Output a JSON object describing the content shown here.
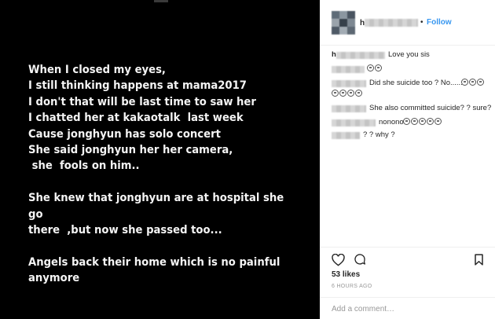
{
  "photo": {
    "caption": "When I closed my eyes,\nI still thinking happens at mama2017\nI don't that will be last time to saw her\nI chatted her at kakaotalk  last week\nCause jonghyun has solo concert\nShe said jonghyun her her camera,\n she  fools on him..\n\nShe knew that jonghyun are at hospital she go\nthere  ,but now she passed too...\n\nAngels back their home which is no painful\nanymore"
  },
  "header": {
    "username_initial": "h",
    "separator": "•",
    "follow_label": "Follow"
  },
  "comments": [
    {
      "name": "h",
      "text": "Love you sis",
      "emoji_count": 0
    },
    {
      "name": "",
      "text": "",
      "emoji_count": 2
    },
    {
      "name": "",
      "text": "Did she suicide too ? No......",
      "emoji_count": 3
    },
    {
      "name": "",
      "text": "",
      "emoji_count": 4
    },
    {
      "name": "",
      "text": "She also committed suicide? ? sure?",
      "emoji_count": 0
    },
    {
      "name": "",
      "text": "nonono",
      "emoji_count": 5
    },
    {
      "name": "",
      "text": "? ? why ?",
      "emoji_count": 0
    }
  ],
  "actions": {
    "icons": [
      "heart-icon",
      "comment-icon",
      "bookmark-icon"
    ]
  },
  "likes": "53 likes",
  "time": "6 HOURS AGO",
  "add_comment": {
    "placeholder": "Add a comment…"
  },
  "colors": {
    "link": "#3897f0",
    "text": "#262626",
    "muted": "#999999",
    "photo_bg": "#000000"
  }
}
